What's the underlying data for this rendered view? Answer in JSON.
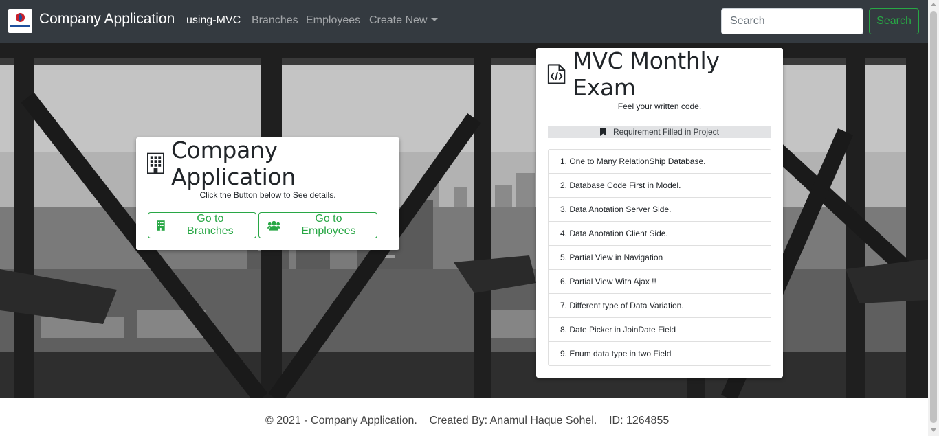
{
  "navbar": {
    "brand": "Company Application",
    "links": [
      {
        "label": "using-MVC",
        "active": true
      },
      {
        "label": "Branches",
        "active": false
      },
      {
        "label": "Employees",
        "active": false
      },
      {
        "label": "Create New",
        "active": false
      }
    ],
    "search_placeholder": "Search",
    "search_button": "Search",
    "logo_icon": "company-logo"
  },
  "app_card": {
    "title": "Company Application",
    "title_icon": "building-icon",
    "subtitle": "Click the Button below to See details.",
    "buttons": [
      {
        "label": "Go to Branches",
        "icon": "building-icon"
      },
      {
        "label": "Go to Employees",
        "icon": "users-icon"
      }
    ]
  },
  "exam_card": {
    "title": "MVC Monthly Exam",
    "title_icon": "code-file-icon",
    "subtitle": "Feel your written code.",
    "banner": "Requirement Filled in Project",
    "banner_icon": "bookmark-icon",
    "requirements": [
      "1. One to Many RelationShip Database.",
      "2. Database Code First in Model.",
      "3. Data Anotation Server Side.",
      "4. Data Anotation Client Side.",
      "5. Partial View in Navigation",
      "6. Partial View With Ajax !!",
      "7. Different type of Data Variation.",
      "8. Date Picker in JoinDate Field",
      "9. Enum data type in two Field"
    ]
  },
  "footer": {
    "text": "© 2021 - Company Application.    Created By: Anamul Haque Sohel.    ID: 1264855"
  },
  "colors": {
    "navbar": "#343a40",
    "success": "#28a745",
    "banner": "#e2e3e5"
  }
}
